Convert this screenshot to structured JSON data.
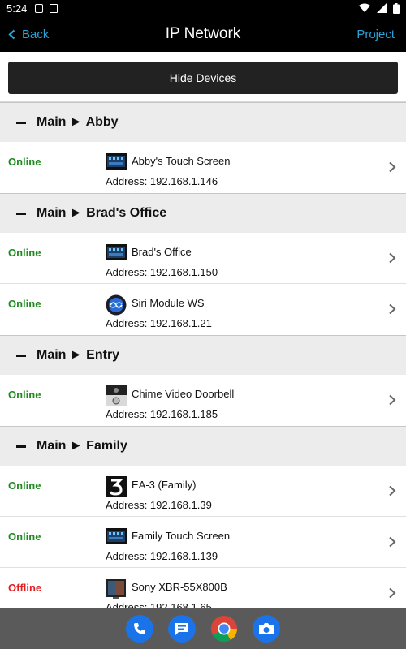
{
  "status_bar": {
    "time": "5:24"
  },
  "nav": {
    "back_label": "Back",
    "title": "IP Network",
    "project_label": "Project"
  },
  "hide_button": {
    "label": "Hide Devices"
  },
  "groups": [
    {
      "title": "Main ► Abby",
      "devices": [
        {
          "status": "Online",
          "name": "Abby's Touch Screen",
          "address": "Address: 192.168.1.146",
          "icon": "touch-screen-icon"
        }
      ]
    },
    {
      "title": "Main ► Brad's Office",
      "devices": [
        {
          "status": "Online",
          "name": "Brad's Office",
          "address": "Address: 192.168.1.150",
          "icon": "touch-screen-icon"
        },
        {
          "status": "Online",
          "name": "Siri Module WS",
          "address": "Address: 192.168.1.21",
          "icon": "siri-icon"
        }
      ]
    },
    {
      "title": "Main ► Entry",
      "devices": [
        {
          "status": "Online",
          "name": "Chime Video Doorbell",
          "address": "Address: 192.168.1.185",
          "icon": "doorbell-icon"
        }
      ]
    },
    {
      "title": "Main ► Family",
      "devices": [
        {
          "status": "Online",
          "name": "EA-3 (Family)",
          "address": "Address: 192.168.1.39",
          "icon": "ea3-icon"
        },
        {
          "status": "Online",
          "name": "Family Touch Screen",
          "address": "Address: 192.168.1.139",
          "icon": "touch-screen-icon"
        },
        {
          "status": "Offline",
          "name": "Sony XBR-55X800B",
          "address": "Address: 192.168.1.65",
          "icon": "tv-icon"
        }
      ]
    }
  ],
  "colors": {
    "online": "#1e8a1e",
    "offline": "#e02020",
    "accent": "#29a3d8"
  },
  "dock_apps": [
    "phone-icon",
    "messages-icon",
    "chrome-icon",
    "camera-icon"
  ]
}
